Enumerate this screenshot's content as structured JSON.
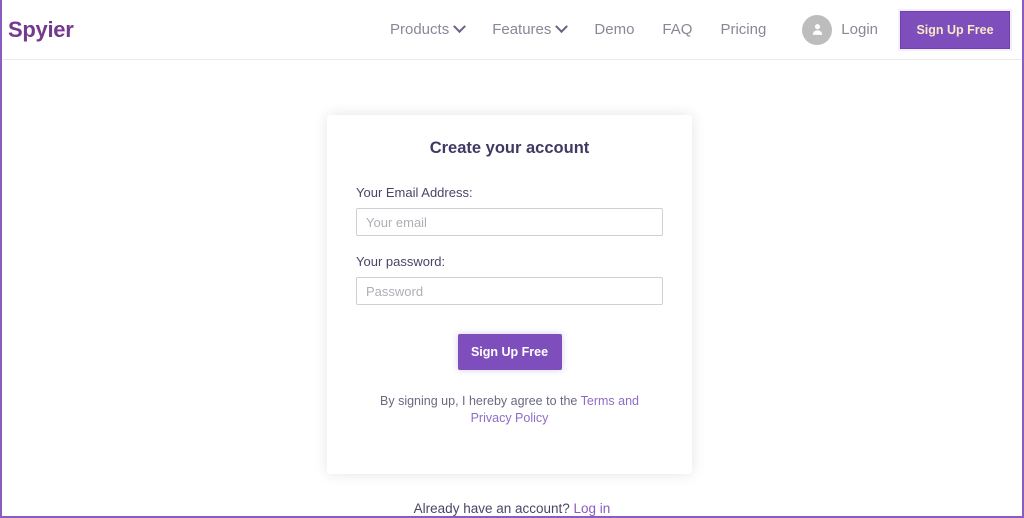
{
  "brand": {
    "name": "Spyier"
  },
  "nav": {
    "items": [
      {
        "label": "Products",
        "has_dropdown": true,
        "icon": "chevron-down-icon"
      },
      {
        "label": "Features",
        "has_dropdown": true,
        "icon": "chevron-down-icon"
      },
      {
        "label": "Demo",
        "has_dropdown": false,
        "icon": ""
      },
      {
        "label": "FAQ",
        "has_dropdown": false,
        "icon": ""
      },
      {
        "label": "Pricing",
        "has_dropdown": false,
        "icon": ""
      }
    ],
    "login": {
      "label": "Login",
      "icon": "user-avatar-icon"
    },
    "signup_button": {
      "label": "Sign Up Free"
    }
  },
  "card": {
    "title": "Create your account",
    "email_field": {
      "label": "Your Email Address:",
      "placeholder": "Your email",
      "value": ""
    },
    "password_field": {
      "label": "Your password:",
      "placeholder": "Password",
      "value": ""
    },
    "submit_button": {
      "label": "Sign Up Free"
    },
    "terms": {
      "prefix": "By signing up, I hereby agree to the ",
      "link": "Terms and Privacy Policy"
    }
  },
  "footer": {
    "already_text": "Already have an account? ",
    "login_link": "Log in"
  },
  "colors": {
    "brand_purple": "#73398e",
    "accent_purple": "#7e4fbc",
    "frame_purple": "#8a5cc0",
    "nav_text": "#8d8598",
    "signup_nav_text": "#f7e9c4",
    "link_purple": "#8f6cc6",
    "heading": "#3f3a63"
  }
}
